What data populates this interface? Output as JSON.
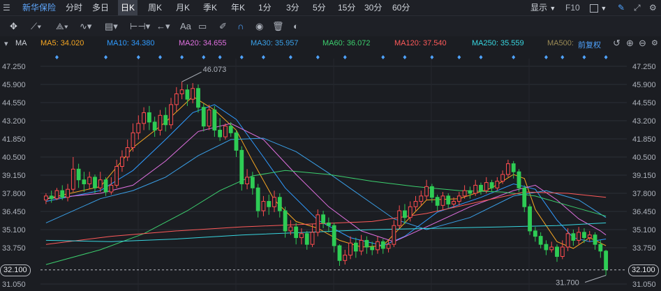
{
  "header": {
    "stock_name": "新华保险",
    "tabs": [
      "分时",
      "多日",
      "日K",
      "周K",
      "月K",
      "季K",
      "年K",
      "1分",
      "3分",
      "5分",
      "15分",
      "30分",
      "60分"
    ],
    "active_tab": "日K",
    "display_label": "显示",
    "f10_label": "F10"
  },
  "toolbar": {
    "text_tool_label": "Aa"
  },
  "ma_bar": {
    "prefix": "MA",
    "items": [
      {
        "label": "MA5: 34.020",
        "color": "#f5a623"
      },
      {
        "label": "MA10: 34.380",
        "color": "#2f9bff"
      },
      {
        "label": "MA20: 34.655",
        "color": "#e070e0"
      },
      {
        "label": "MA30: 35.957",
        "color": "#3aa0e8"
      },
      {
        "label": "MA60: 36.072",
        "color": "#3ccf6e"
      },
      {
        "label": "MA120: 37.540",
        "color": "#ff5a5a"
      },
      {
        "label": "MA250: 35.559",
        "color": "#38d6e0"
      },
      {
        "label": "MA500:",
        "color": "#9a8a55"
      }
    ],
    "adjust_label": "前复权"
  },
  "price_box": {
    "left": "32.100",
    "right": "32.100"
  },
  "chart_data": {
    "type": "candlestick",
    "y_ticks": [
      "47.250",
      "45.900",
      "44.550",
      "43.200",
      "41.850",
      "40.500",
      "39.150",
      "37.800",
      "36.450",
      "35.100",
      "33.750",
      "31.050"
    ],
    "ylim": [
      31.05,
      47.25
    ],
    "current_price": 32.1,
    "high_annotation": "46.073",
    "low_annotation": "31.700",
    "up_color": "#ff4d4f",
    "down_color": "#2ecc55",
    "candles": [
      [
        37.3,
        37.6,
        37.0,
        37.8
      ],
      [
        37.6,
        37.4,
        37.1,
        38.0
      ],
      [
        37.4,
        38.0,
        37.3,
        38.2
      ],
      [
        38.0,
        37.5,
        37.3,
        38.4
      ],
      [
        37.5,
        38.1,
        37.2,
        38.5
      ],
      [
        38.1,
        39.6,
        37.9,
        40.5
      ],
      [
        39.6,
        38.8,
        38.2,
        40.0
      ],
      [
        38.8,
        38.5,
        37.9,
        39.4
      ],
      [
        38.5,
        39.0,
        38.1,
        39.4
      ],
      [
        39.0,
        38.2,
        37.8,
        39.2
      ],
      [
        38.2,
        38.8,
        37.9,
        39.4
      ],
      [
        38.8,
        37.9,
        37.6,
        39.0
      ],
      [
        37.9,
        38.4,
        37.7,
        39.0
      ],
      [
        38.4,
        39.8,
        38.2,
        40.3
      ],
      [
        39.8,
        40.5,
        39.4,
        41.0
      ],
      [
        40.5,
        41.2,
        40.2,
        41.8
      ],
      [
        41.2,
        42.3,
        40.9,
        43.0
      ],
      [
        42.3,
        43.0,
        41.8,
        43.6
      ],
      [
        43.0,
        43.8,
        42.5,
        44.2
      ],
      [
        43.8,
        43.1,
        42.5,
        44.3
      ],
      [
        43.1,
        42.5,
        42.0,
        43.5
      ],
      [
        42.5,
        43.6,
        42.1,
        44.0
      ],
      [
        43.6,
        42.9,
        42.4,
        44.2
      ],
      [
        42.9,
        44.4,
        42.6,
        44.9
      ],
      [
        44.4,
        45.2,
        43.9,
        45.7
      ],
      [
        45.2,
        45.5,
        44.8,
        46.1
      ],
      [
        45.5,
        44.8,
        44.3,
        45.9
      ],
      [
        44.8,
        45.6,
        44.5,
        46.0
      ],
      [
        45.6,
        44.2,
        43.8,
        45.9
      ],
      [
        44.2,
        42.8,
        42.4,
        44.5
      ],
      [
        42.8,
        44.0,
        42.5,
        44.4
      ],
      [
        44.0,
        42.5,
        42.0,
        44.3
      ],
      [
        42.5,
        42.0,
        41.7,
        43.4
      ],
      [
        42.0,
        42.8,
        41.8,
        43.0
      ],
      [
        42.8,
        42.3,
        42.0,
        43.1
      ],
      [
        42.3,
        41.0,
        40.5,
        42.5
      ],
      [
        41.0,
        38.5,
        38.0,
        41.3
      ],
      [
        38.5,
        39.0,
        38.1,
        39.6
      ],
      [
        39.0,
        38.2,
        37.7,
        39.4
      ],
      [
        38.2,
        36.5,
        36.0,
        38.5
      ],
      [
        36.5,
        37.2,
        36.1,
        37.6
      ],
      [
        37.2,
        36.8,
        36.2,
        37.7
      ],
      [
        36.8,
        37.5,
        36.4,
        38.0
      ],
      [
        37.5,
        36.5,
        36.0,
        37.8
      ],
      [
        36.5,
        35.0,
        34.5,
        36.8
      ],
      [
        35.0,
        35.3,
        34.7,
        35.8
      ],
      [
        35.3,
        34.5,
        34.0,
        35.6
      ],
      [
        34.5,
        34.8,
        34.0,
        35.2
      ],
      [
        34.8,
        34.0,
        33.6,
        35.0
      ],
      [
        34.0,
        34.9,
        33.8,
        35.5
      ],
      [
        34.9,
        36.2,
        34.6,
        36.6
      ],
      [
        36.2,
        35.6,
        35.2,
        36.5
      ],
      [
        35.6,
        35.4,
        34.9,
        36.0
      ],
      [
        35.4,
        33.9,
        33.4,
        35.6
      ],
      [
        33.9,
        32.8,
        32.4,
        34.0
      ],
      [
        32.8,
        33.2,
        32.5,
        33.6
      ],
      [
        33.2,
        34.1,
        32.9,
        34.6
      ],
      [
        34.1,
        33.5,
        33.0,
        34.5
      ],
      [
        33.5,
        34.3,
        33.2,
        34.7
      ],
      [
        34.3,
        33.8,
        33.3,
        34.6
      ],
      [
        33.8,
        33.6,
        33.2,
        34.2
      ],
      [
        33.6,
        34.2,
        33.3,
        34.6
      ],
      [
        34.2,
        33.7,
        33.3,
        34.4
      ],
      [
        33.7,
        34.0,
        33.4,
        34.3
      ],
      [
        34.0,
        35.4,
        33.8,
        35.8
      ],
      [
        35.4,
        36.5,
        35.2,
        36.9
      ],
      [
        36.5,
        36.0,
        35.5,
        37.0
      ],
      [
        36.0,
        36.8,
        35.7,
        37.2
      ],
      [
        36.8,
        37.2,
        36.5,
        37.6
      ],
      [
        37.2,
        37.6,
        36.9,
        38.0
      ],
      [
        37.6,
        38.3,
        37.3,
        38.8
      ],
      [
        38.3,
        37.5,
        37.1,
        38.5
      ],
      [
        37.5,
        36.9,
        36.5,
        37.7
      ],
      [
        36.9,
        37.6,
        36.6,
        37.9
      ],
      [
        37.6,
        37.0,
        36.7,
        37.8
      ],
      [
        37.0,
        37.2,
        36.7,
        37.5
      ],
      [
        37.2,
        37.6,
        36.9,
        37.9
      ],
      [
        37.6,
        38.0,
        37.4,
        38.4
      ],
      [
        38.0,
        37.8,
        37.4,
        38.3
      ],
      [
        37.8,
        38.4,
        37.6,
        38.8
      ],
      [
        38.4,
        38.0,
        37.7,
        38.6
      ],
      [
        38.0,
        38.6,
        37.8,
        39.0
      ],
      [
        38.6,
        38.2,
        37.9,
        38.8
      ],
      [
        38.2,
        38.7,
        38.0,
        39.0
      ],
      [
        38.7,
        39.2,
        38.5,
        39.5
      ],
      [
        39.2,
        40.0,
        39.0,
        40.3
      ],
      [
        40.0,
        39.4,
        38.9,
        40.2
      ],
      [
        39.4,
        38.2,
        37.9,
        39.6
      ],
      [
        38.2,
        36.8,
        36.4,
        38.4
      ],
      [
        36.8,
        35.0,
        34.7,
        37.0
      ],
      [
        35.0,
        34.6,
        34.2,
        35.3
      ],
      [
        34.6,
        34.0,
        33.7,
        34.9
      ],
      [
        34.0,
        33.6,
        33.2,
        34.3
      ],
      [
        33.6,
        33.8,
        33.4,
        34.2
      ],
      [
        33.8,
        33.1,
        32.7,
        34.0
      ],
      [
        33.1,
        33.8,
        32.9,
        34.3
      ],
      [
        33.8,
        34.8,
        33.5,
        35.2
      ],
      [
        34.8,
        34.3,
        33.9,
        35.1
      ],
      [
        34.3,
        34.9,
        34.0,
        35.3
      ],
      [
        34.9,
        34.5,
        34.1,
        35.2
      ],
      [
        34.5,
        34.7,
        34.2,
        35.0
      ],
      [
        34.7,
        34.0,
        33.6,
        34.9
      ],
      [
        34.0,
        33.5,
        33.0,
        34.3
      ],
      [
        33.5,
        32.1,
        31.7,
        33.6
      ]
    ],
    "lines": [
      {
        "name": "MA5",
        "color": "#f5a623",
        "points": [
          [
            0,
            37.4
          ],
          [
            10,
            38.3
          ],
          [
            16,
            41.2
          ],
          [
            22,
            43.1
          ],
          [
            27,
            45.0
          ],
          [
            31,
            44.0
          ],
          [
            35,
            42.5
          ],
          [
            38,
            40.2
          ],
          [
            42,
            37.3
          ],
          [
            46,
            35.7
          ],
          [
            50,
            35.2
          ],
          [
            54,
            34.3
          ],
          [
            58,
            33.8
          ],
          [
            62,
            33.9
          ],
          [
            66,
            35.6
          ],
          [
            70,
            37.3
          ],
          [
            76,
            37.4
          ],
          [
            82,
            38.2
          ],
          [
            86,
            39.2
          ],
          [
            88,
            38.9
          ],
          [
            90,
            36.6
          ],
          [
            94,
            34.2
          ],
          [
            97,
            33.7
          ],
          [
            100,
            34.5
          ],
          [
            104,
            33.9
          ]
        ]
      },
      {
        "name": "MA10",
        "color": "#2f9bff",
        "points": [
          [
            0,
            37.2
          ],
          [
            10,
            38.0
          ],
          [
            16,
            39.5
          ],
          [
            22,
            41.8
          ],
          [
            27,
            43.8
          ],
          [
            31,
            44.4
          ],
          [
            35,
            43.3
          ],
          [
            40,
            40.5
          ],
          [
            44,
            38.2
          ],
          [
            50,
            35.8
          ],
          [
            56,
            34.5
          ],
          [
            62,
            33.9
          ],
          [
            66,
            34.6
          ],
          [
            72,
            36.4
          ],
          [
            80,
            37.5
          ],
          [
            86,
            38.5
          ],
          [
            90,
            38.1
          ],
          [
            94,
            35.8
          ],
          [
            97,
            34.5
          ],
          [
            100,
            34.2
          ],
          [
            104,
            34.4
          ]
        ]
      },
      {
        "name": "MA20",
        "color": "#e070e0",
        "points": [
          [
            0,
            37.4
          ],
          [
            10,
            37.8
          ],
          [
            16,
            38.4
          ],
          [
            22,
            40.2
          ],
          [
            28,
            42.4
          ],
          [
            34,
            43.0
          ],
          [
            40,
            41.8
          ],
          [
            46,
            39.2
          ],
          [
            52,
            36.8
          ],
          [
            58,
            35.0
          ],
          [
            64,
            34.2
          ],
          [
            70,
            35.3
          ],
          [
            78,
            36.8
          ],
          [
            86,
            38.0
          ],
          [
            90,
            38.4
          ],
          [
            94,
            37.3
          ],
          [
            98,
            35.9
          ],
          [
            102,
            35.0
          ],
          [
            104,
            34.7
          ]
        ]
      },
      {
        "name": "MA30",
        "color": "#3aa0e8",
        "points": [
          [
            0,
            35.6
          ],
          [
            10,
            37.4
          ],
          [
            16,
            38.0
          ],
          [
            22,
            39.0
          ],
          [
            28,
            40.6
          ],
          [
            34,
            41.8
          ],
          [
            40,
            41.9
          ],
          [
            46,
            40.9
          ],
          [
            52,
            39.3
          ],
          [
            58,
            37.6
          ],
          [
            64,
            35.9
          ],
          [
            70,
            35.1
          ],
          [
            78,
            36.0
          ],
          [
            86,
            37.6
          ],
          [
            92,
            38.0
          ],
          [
            98,
            37.3
          ],
          [
            104,
            36.0
          ]
        ]
      },
      {
        "name": "MA60",
        "color": "#3ccf6e",
        "points": [
          [
            0,
            32.5
          ],
          [
            10,
            33.6
          ],
          [
            18,
            34.8
          ],
          [
            26,
            36.5
          ],
          [
            32,
            38.0
          ],
          [
            38,
            39.1
          ],
          [
            44,
            39.5
          ],
          [
            52,
            39.2
          ],
          [
            60,
            38.7
          ],
          [
            68,
            38.3
          ],
          [
            76,
            38.0
          ],
          [
            84,
            37.9
          ],
          [
            90,
            37.6
          ],
          [
            96,
            36.9
          ],
          [
            104,
            36.1
          ]
        ]
      },
      {
        "name": "MA120",
        "color": "#ff5a5a",
        "points": [
          [
            0,
            34.0
          ],
          [
            12,
            34.6
          ],
          [
            24,
            35.0
          ],
          [
            36,
            35.3
          ],
          [
            48,
            35.5
          ],
          [
            60,
            35.7
          ],
          [
            70,
            36.3
          ],
          [
            80,
            37.2
          ],
          [
            88,
            37.9
          ],
          [
            96,
            37.8
          ],
          [
            104,
            37.5
          ]
        ]
      },
      {
        "name": "MA250",
        "color": "#38d6e0",
        "points": [
          [
            0,
            34.3
          ],
          [
            12,
            34.2
          ],
          [
            24,
            34.4
          ],
          [
            36,
            34.7
          ],
          [
            48,
            34.9
          ],
          [
            60,
            35.1
          ],
          [
            72,
            35.2
          ],
          [
            84,
            35.3
          ],
          [
            94,
            35.4
          ],
          [
            104,
            35.6
          ]
        ]
      }
    ]
  }
}
